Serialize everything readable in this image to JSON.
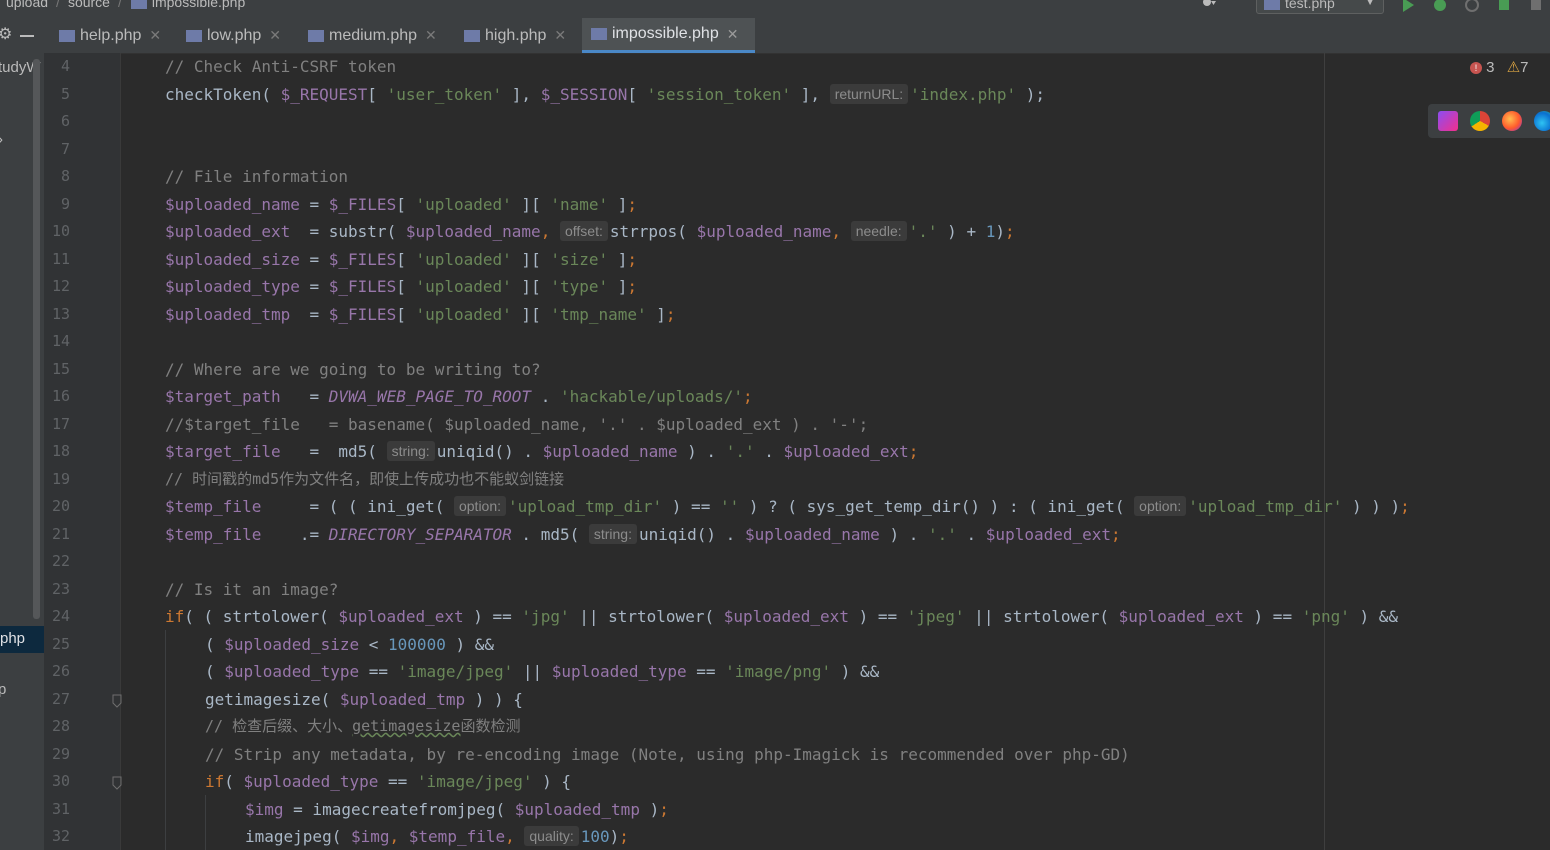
{
  "breadcrumb": {
    "items": [
      "upload",
      "source",
      "impossible.php"
    ]
  },
  "toolbar": {
    "run_config": "test.php"
  },
  "tabs": [
    {
      "label": "help.php"
    },
    {
      "label": "low.php"
    },
    {
      "label": "medium.php"
    },
    {
      "label": "high.php"
    },
    {
      "label": "impossible.php"
    }
  ],
  "left_panel": {
    "project_fragment": "tudyW",
    "selected_fragment": "php",
    "item_fragment_2": "p"
  },
  "inspections": {
    "errors": "3",
    "warnings": "7"
  },
  "colors": {
    "accent": "#4a88c7",
    "keyword": "#cc7832",
    "variable": "#9876aa",
    "string": "#6a8759",
    "comment": "#808080",
    "number": "#6897bb"
  },
  "line_numbers": [
    "4",
    "5",
    "6",
    "7",
    "8",
    "9",
    "10",
    "11",
    "12",
    "13",
    "14",
    "15",
    "16",
    "17",
    "18",
    "19",
    "20",
    "21",
    "22",
    "23",
    "24",
    "25",
    "26",
    "27",
    "28",
    "29",
    "30",
    "31",
    "32"
  ],
  "code": {
    "l4": {
      "c1": "// Check Anti-CSRF token"
    },
    "l5": {
      "t1": "checkToken( ",
      "v1": "$_REQUEST",
      "t2": "[ ",
      "s1": "'user_token'",
      "t3": " ], ",
      "v2": "$_SESSION",
      "t4": "[ ",
      "s2": "'session_token'",
      "t5": " ], ",
      "h1": "returnURL:",
      "s3": "'index.php'",
      "t6": " );"
    },
    "l8": {
      "c1": "// File information"
    },
    "l9": {
      "v1": "$uploaded_name",
      "t1": " = ",
      "v2": "$_FILES",
      "t2": "[ ",
      "s1": "'uploaded'",
      "t3": " ][ ",
      "s2": "'name'",
      "t4": " ]",
      "k1": ";"
    },
    "l10": {
      "v1": "$uploaded_ext",
      "t1": "  = substr( ",
      "v2": "$uploaded_name",
      "k1": ",",
      "t2": " ",
      "h1": "offset:",
      "t3": "strrpos( ",
      "v3": "$uploaded_name",
      "k2": ",",
      "t4": " ",
      "h2": "needle:",
      "s1": "'.'",
      "t5": " ) + ",
      "n1": "1",
      "t6": ")",
      "k3": ";"
    },
    "l11": {
      "v1": "$uploaded_size",
      "t1": " = ",
      "v2": "$_FILES",
      "t2": "[ ",
      "s1": "'uploaded'",
      "t3": " ][ ",
      "s2": "'size'",
      "t4": " ]",
      "k1": ";"
    },
    "l12": {
      "v1": "$uploaded_type",
      "t1": " = ",
      "v2": "$_FILES",
      "t2": "[ ",
      "s1": "'uploaded'",
      "t3": " ][ ",
      "s2": "'type'",
      "t4": " ]",
      "k1": ";"
    },
    "l13": {
      "v1": "$uploaded_tmp",
      "t1": "  = ",
      "v2": "$_FILES",
      "t2": "[ ",
      "s1": "'uploaded'",
      "t3": " ][ ",
      "s2": "'tmp_name'",
      "t4": " ]",
      "k1": ";"
    },
    "l15": {
      "c1": "// Where are we going to be writing to?"
    },
    "l16": {
      "v1": "$target_path",
      "t1": "   = ",
      "cst1": "DVWA_WEB_PAGE_TO_ROOT",
      "t2": " . ",
      "s1": "'hackable/uploads/'",
      "k1": ";"
    },
    "l17": {
      "c1": "//$target_file   = basename( $uploaded_name, '.' . $uploaded_ext ) . '-';"
    },
    "l18": {
      "v1": "$target_file",
      "t1": "   =  md5( ",
      "h1": "string:",
      "t2": "uniqid() . ",
      "v2": "$uploaded_name",
      "t3": " ) . ",
      "s1": "'.'",
      "t4": " . ",
      "v3": "$uploaded_ext",
      "k1": ";"
    },
    "l19": {
      "c1": "// 时间戳的md5作为文件名，即使上传成功也不能蚁剑链接"
    },
    "l20": {
      "v1": "$temp_file",
      "t1": "     = ( ( ini_get( ",
      "h1": "option:",
      "s1": "'upload_tmp_dir'",
      "t2": " ) == ",
      "s2": "''",
      "t3": " ) ? ( sys_get_temp_dir() ) : ( ini_get( ",
      "h2": "option:",
      "s3": "'upload_tmp_dir'",
      "t4": " ) ) )",
      "k1": ";"
    },
    "l21": {
      "v1": "$temp_file",
      "t1": "    .= ",
      "cst1": "DIRECTORY_SEPARATOR",
      "t2": " . md5( ",
      "h1": "string:",
      "t3": "uniqid() . ",
      "v2": "$uploaded_name",
      "t4": " ) . ",
      "s1": "'.'",
      "t5": " . ",
      "v3": "$uploaded_ext",
      "k1": ";"
    },
    "l23": {
      "c1": "// Is it an image?"
    },
    "l24": {
      "k1": "if",
      "t1": "( ( strtolower( ",
      "v1": "$uploaded_ext",
      "t2": " ) == ",
      "s1": "'jpg'",
      "t3": " || strtolower( ",
      "v2": "$uploaded_ext",
      "t4": " ) == ",
      "s2": "'jpeg'",
      "t5": " || strtolower( ",
      "v3": "$uploaded_ext",
      "t6": " ) == ",
      "s3": "'png'",
      "t7": " ) &&"
    },
    "l25": {
      "t1": "( ",
      "v1": "$uploaded_size",
      "t2": " < ",
      "n1": "100000",
      "t3": " ) &&"
    },
    "l26": {
      "t1": "( ",
      "v1": "$uploaded_type",
      "t2": " == ",
      "s1": "'image/jpeg'",
      "t3": " || ",
      "v2": "$uploaded_type",
      "t4": " == ",
      "s2": "'image/png'",
      "t5": " ) &&"
    },
    "l27": {
      "t1": "getimagesize( ",
      "v1": "$uploaded_tmp",
      "t2": " ) ) {"
    },
    "l28": {
      "c1": "// 检查后缀、大小、",
      "c2": "getimagesize",
      "c3": "函数检测"
    },
    "l29": {
      "c1": "// Strip any metadata, by re-encoding image (Note, using php-Imagick is recommended over php-GD)"
    },
    "l30": {
      "k1": "if",
      "t1": "( ",
      "v1": "$uploaded_type",
      "t2": " == ",
      "s1": "'image/jpeg'",
      "t3": " ) {"
    },
    "l31": {
      "v1": "$img",
      "t1": " = imagecreatefromjpeg( ",
      "v2": "$uploaded_tmp",
      "t2": " )",
      "k1": ";"
    },
    "l32": {
      "t1": "imagejpeg( ",
      "v1": "$img",
      "k1": ",",
      "t2": " ",
      "v2": "$temp_file",
      "k2": ",",
      "t3": " ",
      "h1": "quality:",
      "n1": "100",
      "t4": ")",
      "k3": ";"
    }
  }
}
